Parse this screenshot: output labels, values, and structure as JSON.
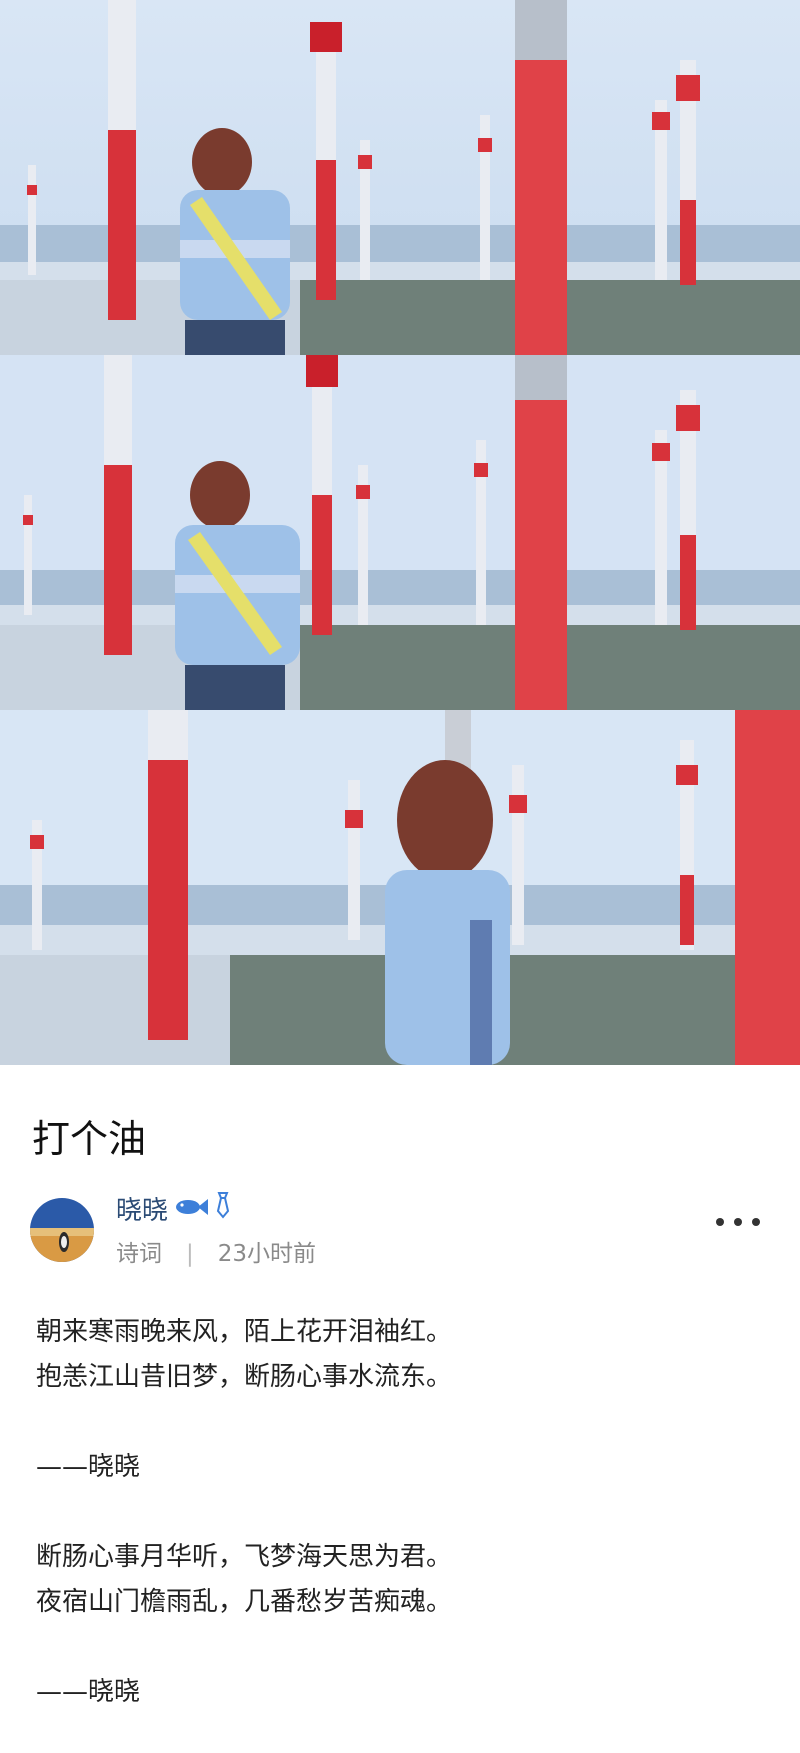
{
  "images": [
    {
      "alt": "",
      "name": "photo-frame-1"
    },
    {
      "alt": "",
      "name": "photo-frame-2"
    },
    {
      "alt": "",
      "name": "photo-frame-3"
    }
  ],
  "post": {
    "title": "打个油",
    "author": {
      "name": "晓晓",
      "badges": [
        "fish-icon",
        "tie-icon"
      ]
    },
    "category": "诗词",
    "separator": "|",
    "time": "23小时前",
    "lines": [
      "朝来寒雨晚来风，陌上花开泪袖红。",
      "抱恙江山昔旧梦，断肠心事水流东。",
      "",
      "——晓晓",
      "",
      "断肠心事月华听，飞梦海天思为君。",
      "夜宿山门檐雨乱，几番愁岁苦痴魂。",
      "",
      "——晓晓"
    ]
  },
  "colors": {
    "accent": "#2b4b75",
    "pole_red": "#d7323a",
    "sky": "#cfdff2"
  }
}
